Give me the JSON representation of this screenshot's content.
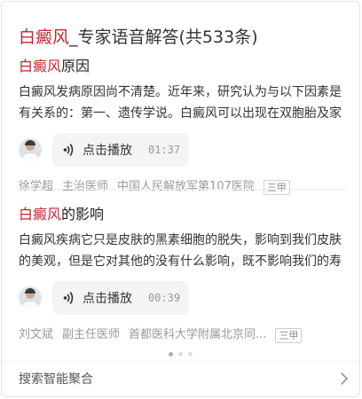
{
  "header": {
    "keyword": "白癜风",
    "title_rest": "_专家语音解答(共533条)"
  },
  "answers": [
    {
      "keyword": "白癜风",
      "title_rest": "原因",
      "description": "白癜风发病原因尚不清楚。近年来，研究认为与以下因素是有关系的：第一、遗传学说。白癜风可以出现在双胞胎及家族...",
      "play_label": "点击播放",
      "duration": "01:37",
      "doctor_name": "徐学超",
      "doctor_title": "主治医师",
      "hospital": "中国人民解放军第107医院",
      "grade": "三甲"
    },
    {
      "keyword": "白癜风",
      "title_rest": "的影响",
      "description": "白癜风疾病它只是皮肤的黑素细胞的脱失，影响到我们皮肤的美观，但是它对其他的没有什么影响，既不影响我们的寿命...",
      "play_label": "点击播放",
      "duration": "00:39",
      "doctor_name": "刘文斌",
      "doctor_title": "副主任医师",
      "hospital": "首都医科大学附属北京同...",
      "grade": "三甲"
    }
  ],
  "pagination": {
    "total": 3,
    "active": 0
  },
  "footer": {
    "label": "搜索智能聚合"
  },
  "colors": {
    "highlight": "#c2262f",
    "meta": "#999999",
    "audio_bg": "#f4f4f4"
  },
  "icons": {
    "audio": "sound-wave-icon",
    "footer": "chevron-right-icon"
  }
}
